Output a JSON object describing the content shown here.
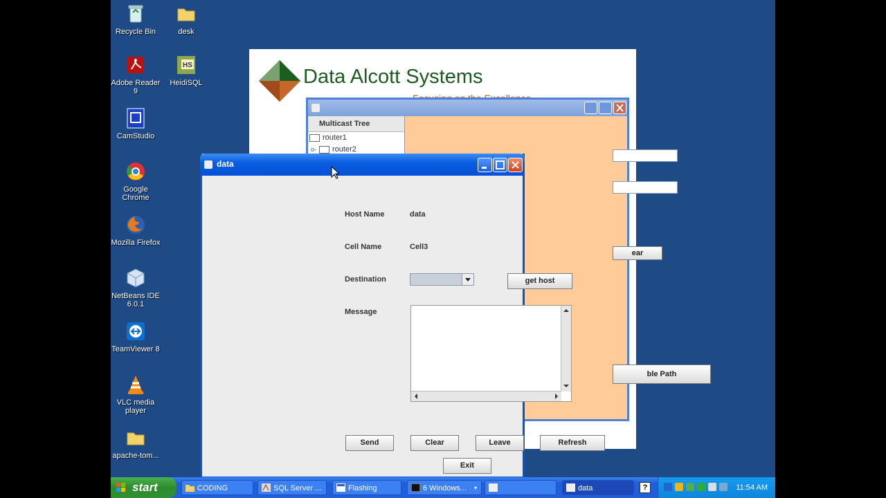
{
  "desktop": {
    "icons": [
      {
        "label": "Recycle Bin",
        "icon": "recycle-bin-icon"
      },
      {
        "label": "desk",
        "icon": "folder-icon"
      },
      {
        "label": "Adobe Reader 9",
        "icon": "adobe-reader-icon"
      },
      {
        "label": "HeidiSQL",
        "icon": "heidisql-icon"
      },
      {
        "label": "CamStudio",
        "icon": "camstudio-icon"
      },
      {
        "label": "Google Chrome",
        "icon": "chrome-icon"
      },
      {
        "label": "Mozilla Firefox",
        "icon": "firefox-icon"
      },
      {
        "label": "NetBeans IDE 6.0.1",
        "icon": "netbeans-icon"
      },
      {
        "label": "TeamViewer 8",
        "icon": "teamviewer-icon"
      },
      {
        "label": "VLC media player",
        "icon": "vlc-icon"
      },
      {
        "label": "apache-tom...",
        "icon": "folder-icon"
      }
    ]
  },
  "splash": {
    "title": "Data Alcott Systems",
    "tagline": "Focusing on the Excellence"
  },
  "multicast_window": {
    "tree_header": "Multicast Tree",
    "nodes": [
      "router1",
      "router2"
    ],
    "clear_button": "ear",
    "path_button": "ble Path"
  },
  "data_window": {
    "title": "data",
    "host_name_label": "Host Name",
    "host_name_value": "data",
    "cell_name_label": "Cell Name",
    "cell_name_value": "Cell3",
    "destination_label": "Destination",
    "destination_value": "",
    "get_host_button": "get host",
    "message_label": "Message",
    "message_value": "",
    "buttons": {
      "send": "Send",
      "clear": "Clear",
      "leave": "Leave",
      "refresh": "Refresh",
      "exit": "Exit"
    }
  },
  "taskbar": {
    "start_label": "start",
    "items": [
      {
        "label": "CODING",
        "icon": "folder-icon"
      },
      {
        "label": "SQL Server ...",
        "icon": "sql-server-icon"
      },
      {
        "label": "Flashing",
        "icon": "window-icon"
      },
      {
        "label": "6 Windows...",
        "icon": "cmd-icon"
      },
      {
        "label": "",
        "icon": "java-icon"
      },
      {
        "label": "data",
        "icon": "java-icon"
      }
    ],
    "clock": "11:54 AM"
  },
  "colors": {
    "desktop": "#1e4b86",
    "orange_panel": "#ffcc99",
    "xp_blue": "#0a5ee0",
    "start_green": "#2e8b2e"
  }
}
